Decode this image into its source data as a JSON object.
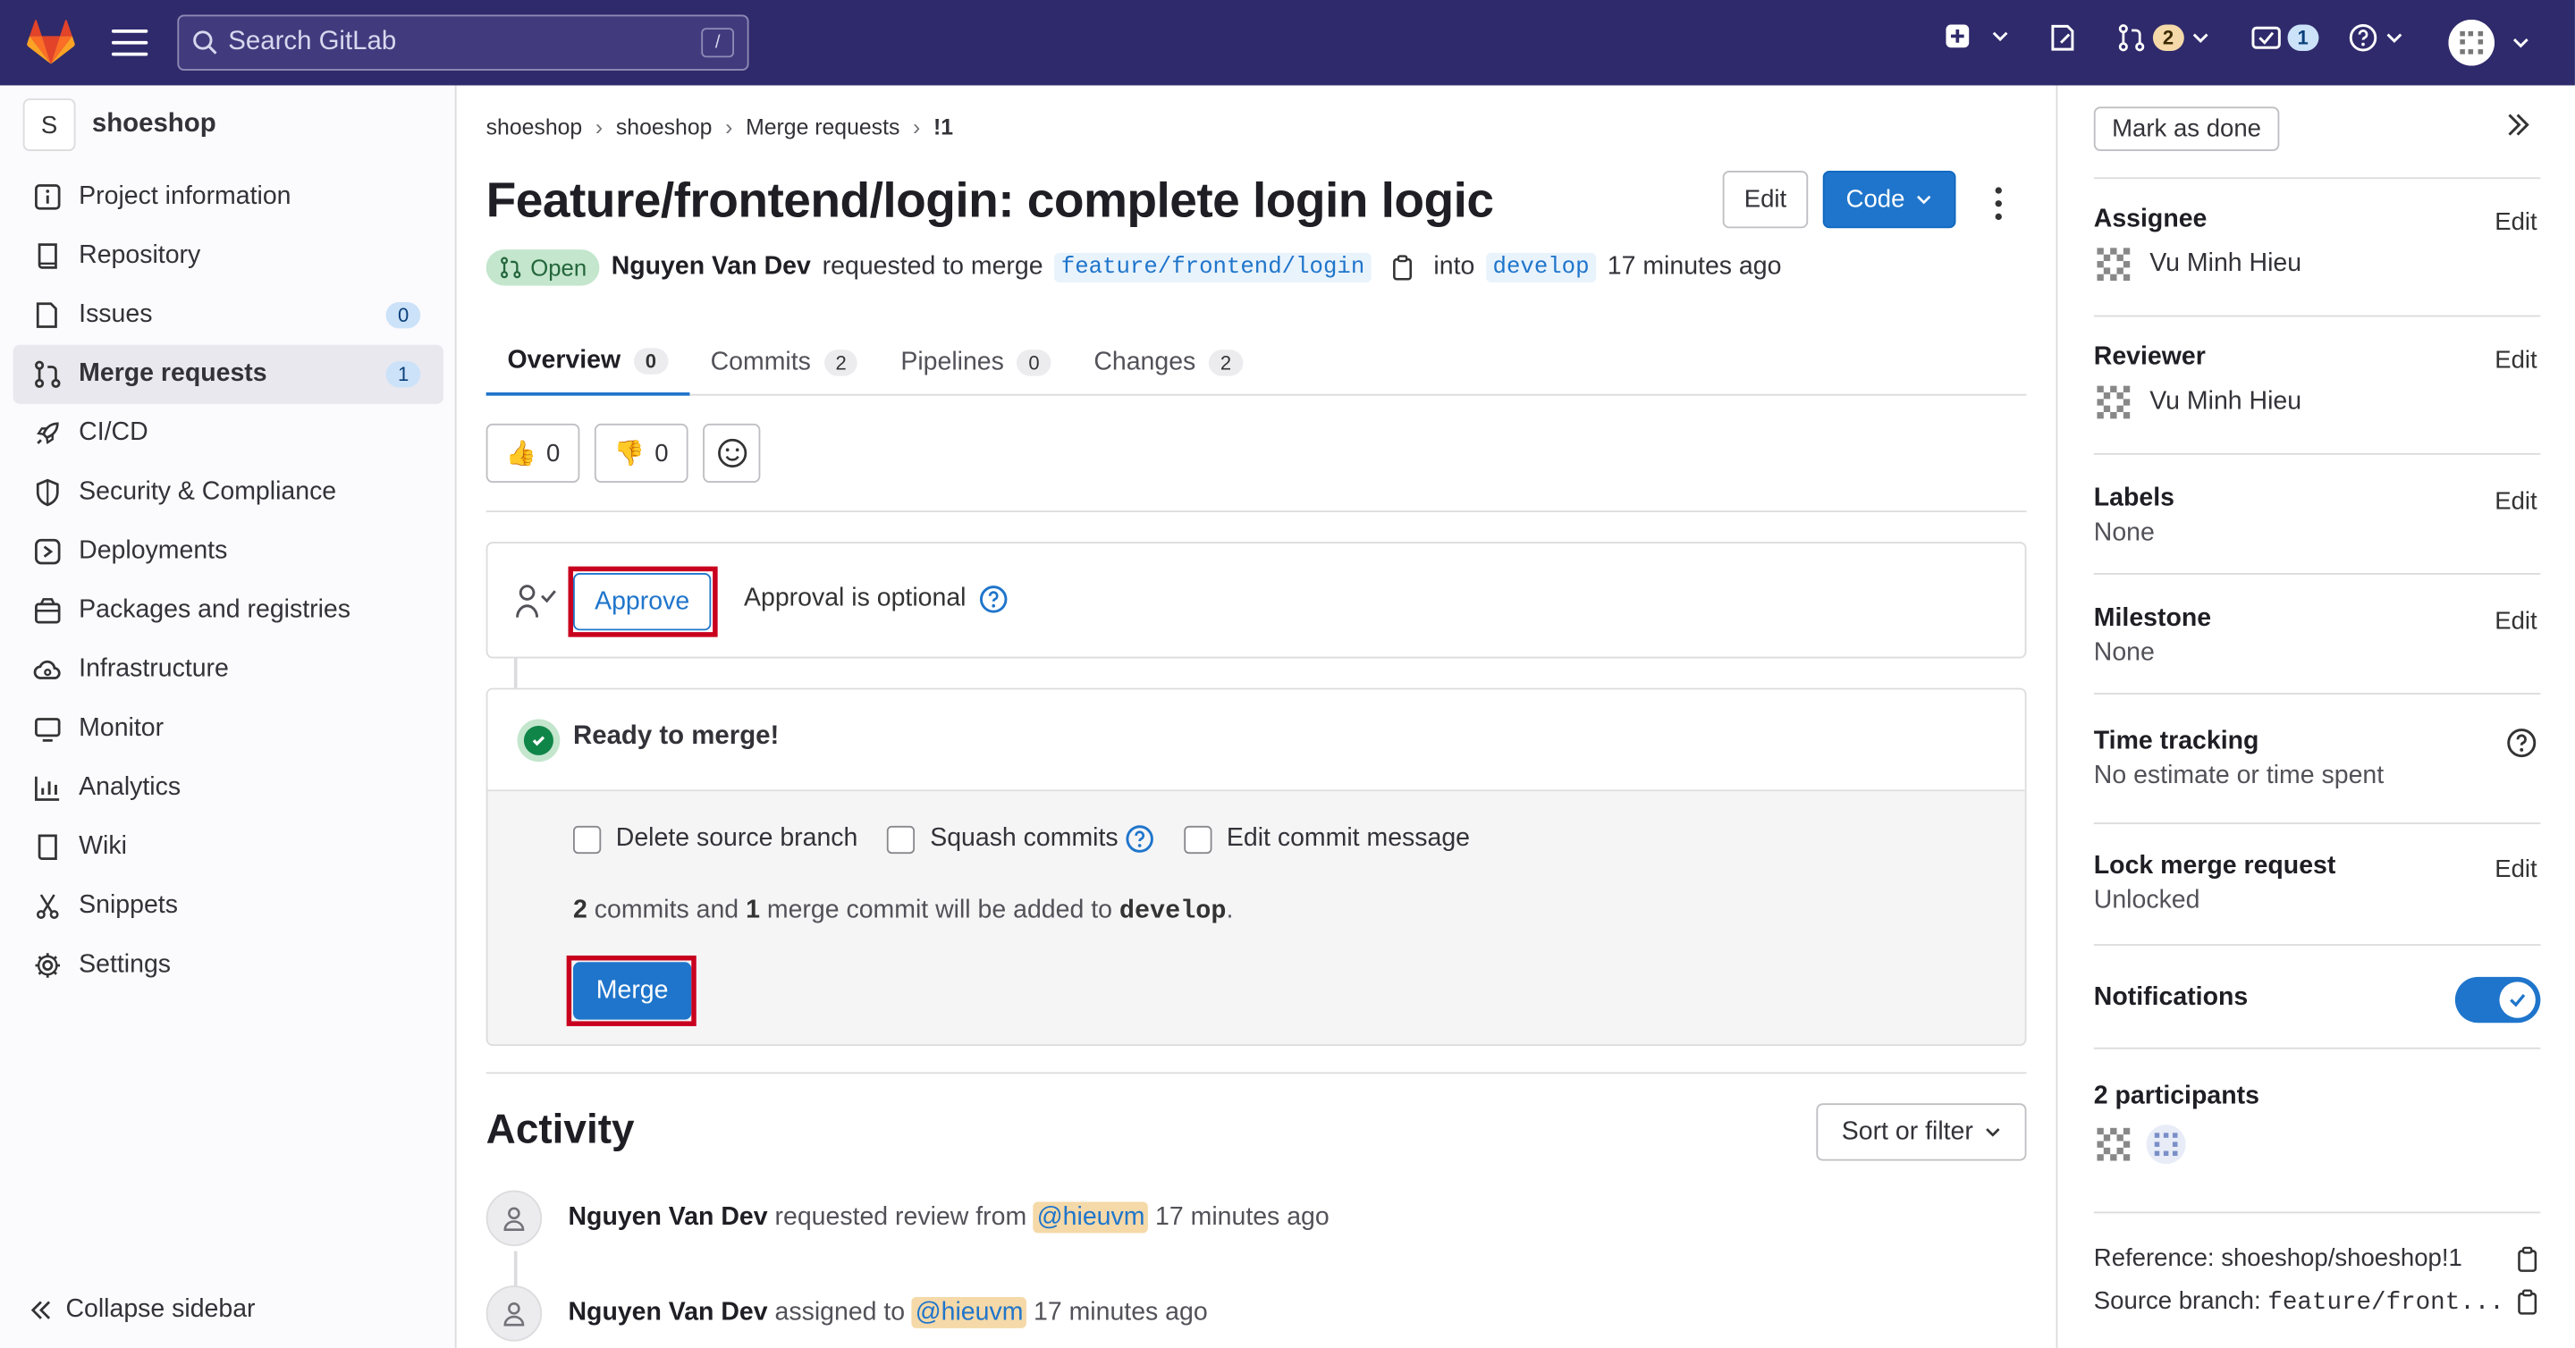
{
  "topbar": {
    "search_placeholder": "Search GitLab",
    "search_shortcut": "/",
    "merge_requests_count": "2",
    "todos_count": "1"
  },
  "sidebar": {
    "project_initial": "S",
    "project_name": "shoeshop",
    "items": [
      {
        "label": "Project information",
        "icon": "info-icon"
      },
      {
        "label": "Repository",
        "icon": "book-icon"
      },
      {
        "label": "Issues",
        "icon": "issues-icon",
        "count": "0"
      },
      {
        "label": "Merge requests",
        "icon": "merge-request-icon",
        "count": "1",
        "active": true
      },
      {
        "label": "CI/CD",
        "icon": "rocket-icon"
      },
      {
        "label": "Security & Compliance",
        "icon": "shield-icon"
      },
      {
        "label": "Deployments",
        "icon": "deployments-icon"
      },
      {
        "label": "Packages and registries",
        "icon": "package-icon"
      },
      {
        "label": "Infrastructure",
        "icon": "cloud-icon"
      },
      {
        "label": "Monitor",
        "icon": "monitor-icon"
      },
      {
        "label": "Analytics",
        "icon": "chart-icon"
      },
      {
        "label": "Wiki",
        "icon": "wiki-icon"
      },
      {
        "label": "Snippets",
        "icon": "snippet-icon"
      },
      {
        "label": "Settings",
        "icon": "gear-icon"
      }
    ],
    "collapse_label": "Collapse sidebar"
  },
  "breadcrumb": [
    "shoeshop",
    "shoeshop",
    "Merge requests",
    "!1"
  ],
  "mr": {
    "title": "Feature/frontend/login: complete login logic",
    "edit_label": "Edit",
    "code_label": "Code",
    "status": "Open",
    "author": "Nguyen Van Dev",
    "requested_text": "requested to merge",
    "source_branch": "feature/frontend/login",
    "into_text": "into",
    "target_branch": "develop",
    "time": "17 minutes ago"
  },
  "tabs": [
    {
      "label": "Overview",
      "count": "0"
    },
    {
      "label": "Commits",
      "count": "2"
    },
    {
      "label": "Pipelines",
      "count": "0"
    },
    {
      "label": "Changes",
      "count": "2"
    }
  ],
  "reactions": {
    "thumbs_up": "👍",
    "thumbs_up_count": "0",
    "thumbs_down": "👎",
    "thumbs_down_count": "0"
  },
  "approval": {
    "button": "Approve",
    "text": "Approval is optional"
  },
  "merge_widget": {
    "status": "Ready to merge!",
    "option_delete": "Delete source branch",
    "option_squash": "Squash commits",
    "option_edit": "Edit commit message",
    "commits_count": "2",
    "commits_text": "commits and",
    "merge_commits_count": "1",
    "merge_commit_text": "merge commit will be added to",
    "target_branch": "develop",
    "end_period": ".",
    "merge_button": "Merge"
  },
  "activity": {
    "title": "Activity",
    "sort_label": "Sort or filter",
    "rows": [
      {
        "author": "Nguyen Van Dev",
        "text": "requested review from",
        "mention": "@hieuvm",
        "time": "17 minutes ago"
      },
      {
        "author": "Nguyen Van Dev",
        "text": "assigned to",
        "mention": "@hieuvm",
        "time": "17 minutes ago"
      }
    ]
  },
  "right_sidebar": {
    "mark_done": "Mark as done",
    "assignee_title": "Assignee",
    "assignee_name": "Vu Minh Hieu",
    "reviewer_title": "Reviewer",
    "reviewer_name": "Vu Minh Hieu",
    "labels_title": "Labels",
    "labels_value": "None",
    "milestone_title": "Milestone",
    "milestone_value": "None",
    "time_title": "Time tracking",
    "time_value": "No estimate or time spent",
    "lock_title": "Lock merge request",
    "lock_value": "Unlocked",
    "notifications_title": "Notifications",
    "notifications_on": true,
    "participants_title": "2 participants",
    "edit_label": "Edit",
    "reference": "Reference: shoeshop/shoeshop!1",
    "source_branch_label": "Source branch:",
    "source_branch_value": "feature/front..."
  },
  "colors": {
    "topbar": "#2f2a6b",
    "primary": "#1f75cb",
    "success": "#108548",
    "highlight": "#c8001e"
  }
}
